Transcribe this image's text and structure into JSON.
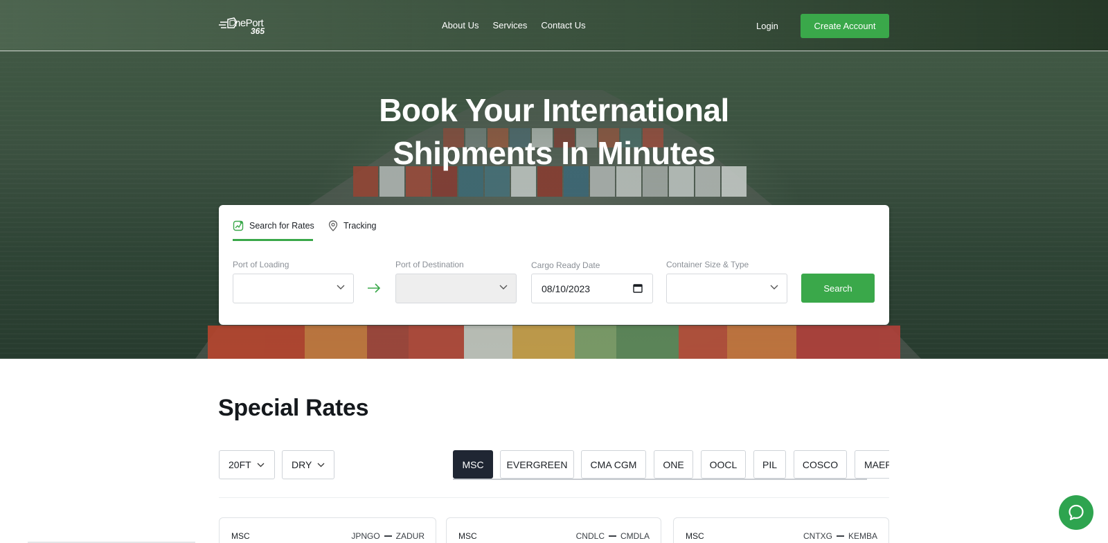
{
  "header": {
    "logo_text": "nePort",
    "logo_number": "365",
    "nav": [
      "About Us",
      "Services",
      "Contact Us"
    ],
    "login": "Login",
    "create_account": "Create Account"
  },
  "hero": {
    "title_line1": "Book Your International",
    "title_line2": "Shipments In Minutes"
  },
  "search": {
    "tabs": [
      "Search for Rates",
      "Tracking"
    ],
    "active_tab": "Search for Rates",
    "port_of_loading_label": "Port of Loading",
    "port_of_destination_label": "Port of Destination",
    "cargo_ready_date_label": "Cargo Ready Date",
    "cargo_ready_date_value": "08/10/2023",
    "container_label": "Container Size & Type",
    "search_button": "Search"
  },
  "special_rates": {
    "title": "Special Rates",
    "size_filter": "20FT",
    "type_filter": "DRY",
    "carriers": [
      "MSC",
      "EVERGREEN",
      "CMA CGM",
      "ONE",
      "OOCL",
      "PIL",
      "COSCO",
      "MAER"
    ],
    "active_carrier": "MSC",
    "cards": [
      {
        "carrier": "MSC",
        "from": "JPNGO",
        "to": "ZADUR"
      },
      {
        "carrier": "MSC",
        "from": "CNDLC",
        "to": "CMDLA"
      },
      {
        "carrier": "MSC",
        "from": "CNTXG",
        "to": "KEMBA"
      }
    ]
  },
  "colors": {
    "accent_green": "#3aa84a",
    "chip_active": "#1f2633",
    "chat_green": "#2ea44f"
  }
}
